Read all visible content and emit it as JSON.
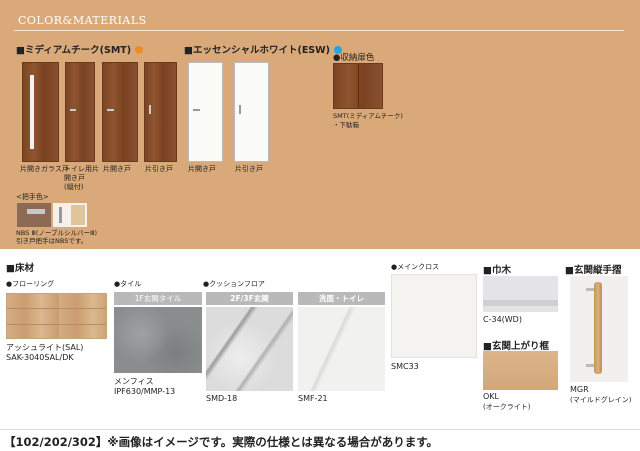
{
  "header": {
    "title": "COLOR&MATERIALS"
  },
  "doors": {
    "smt_title": "■ミディアムチーク(SMT)",
    "smt_color": "#f08a24",
    "esw_title": "■エッセンシャルホワイト(ESW)",
    "esw_color": "#29a3e0",
    "storage_title": "●収納扉色",
    "smt_labels": [
      "片開きガラス戸",
      "トイレ用片\n開き戸\n(縦付)",
      "片開き戸",
      "片引き戸"
    ],
    "esw_labels": [
      "片開き戸",
      "片引き戸"
    ],
    "storage_label": "SMT(ミディアムチーク)\n・下駄箱",
    "handle_title": "<把手色>",
    "handle_label": "NBS Ⅲ(ノーブルシルバーⅢ)\n引き戸把手はNBSです。"
  },
  "flooring": {
    "title": "■床材",
    "flooring_sub": "●フローリング",
    "tile_sub": "●タイル",
    "cushion_sub": "●クッションフロア",
    "tile_head": "1F玄関タイル",
    "cf_head_1": "2F/3F玄関",
    "cf_head_2": "洗面・トイレ",
    "flooring_name": "アッシュライト(SAL)",
    "flooring_code": "SAK-3040SAL/DK",
    "tile_name": "メンフィス",
    "tile_code": "IPF630/MMP-13",
    "cf_code_1": "SMD-18",
    "cf_code_2": "SMF-21"
  },
  "cloth": {
    "sub": "●メインクロス",
    "code": "SMC33"
  },
  "habaki": {
    "title": "■巾木",
    "code": "C-34(WD)"
  },
  "agarikamachi": {
    "title": "■玄関上がり框",
    "code": "OKL",
    "name": "(オークライト)"
  },
  "tesuri": {
    "title": "■玄関縦手摺",
    "code": "MGR",
    "name": "(マイルドグレイン)"
  },
  "footer": {
    "note": "【102/202/302】※画像はイメージです。実際の仕様とは異なる場合があります。"
  }
}
